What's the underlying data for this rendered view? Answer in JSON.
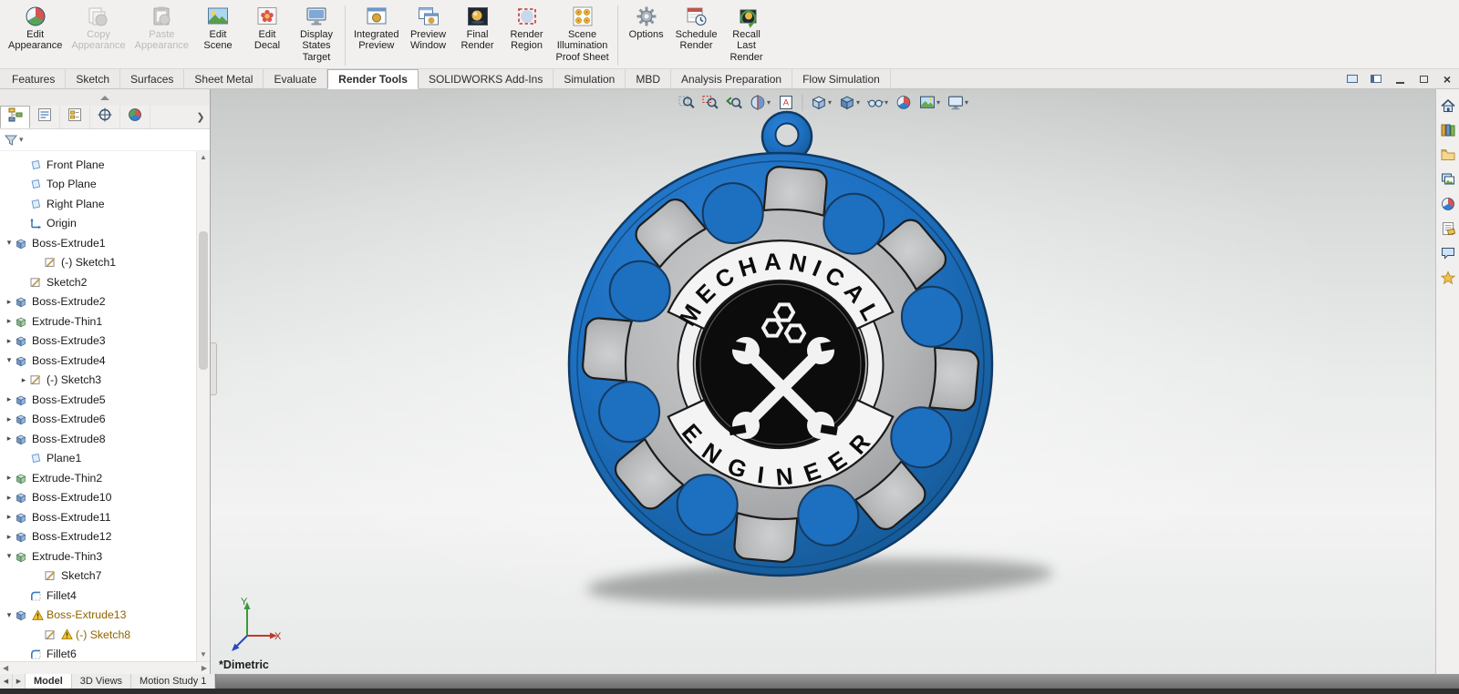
{
  "ribbon": {
    "buttons": [
      {
        "label": "Edit\nAppearance",
        "icon": "edit-appearance",
        "enabled": true
      },
      {
        "label": "Copy\nAppearance",
        "icon": "copy-appearance",
        "enabled": false
      },
      {
        "label": "Paste\nAppearance",
        "icon": "paste-appearance",
        "enabled": false
      },
      {
        "label": "Edit\nScene",
        "icon": "edit-scene",
        "enabled": true
      },
      {
        "label": "Edit\nDecal",
        "icon": "edit-decal",
        "enabled": true
      },
      {
        "label": "Display\nStates\nTarget",
        "icon": "display-states-target",
        "enabled": true
      },
      {
        "label": "Integrated\nPreview",
        "icon": "integrated-preview",
        "enabled": true,
        "group_start": true
      },
      {
        "label": "Preview\nWindow",
        "icon": "preview-window",
        "enabled": true
      },
      {
        "label": "Final\nRender",
        "icon": "final-render",
        "enabled": true
      },
      {
        "label": "Render\nRegion",
        "icon": "render-region",
        "enabled": true
      },
      {
        "label": "Scene\nIllumination\nProof Sheet",
        "icon": "scene-illumination-proof-sheet",
        "enabled": true
      },
      {
        "label": "Options",
        "icon": "options",
        "enabled": true,
        "group_start": true
      },
      {
        "label": "Schedule\nRender",
        "icon": "schedule-render",
        "enabled": true
      },
      {
        "label": "Recall\nLast\nRender",
        "icon": "recall-last-render",
        "enabled": true
      }
    ]
  },
  "command_tabs": {
    "items": [
      "Features",
      "Sketch",
      "Surfaces",
      "Sheet Metal",
      "Evaluate",
      "Render Tools",
      "SOLIDWORKS Add-Ins",
      "Simulation",
      "MBD",
      "Analysis Preparation",
      "Flow Simulation"
    ],
    "active": "Render Tools"
  },
  "manager_panel": {
    "tabs": [
      {
        "name": "featuremanager-design-tree"
      },
      {
        "name": "propertymanager"
      },
      {
        "name": "configurationmanager"
      },
      {
        "name": "dimxpertmanager"
      },
      {
        "name": "displaymanager"
      }
    ],
    "active_index": 0,
    "tree": {
      "items": [
        {
          "label": "Front Plane",
          "depth": 1,
          "icon": "plane"
        },
        {
          "label": "Top Plane",
          "depth": 1,
          "icon": "plane"
        },
        {
          "label": "Right Plane",
          "depth": 1,
          "icon": "plane"
        },
        {
          "label": "Origin",
          "depth": 1,
          "icon": "origin"
        },
        {
          "label": "Boss-Extrude1",
          "depth": 0,
          "expander": "expanded",
          "icon": "boss"
        },
        {
          "label": "(-) Sketch1",
          "depth": 2,
          "icon": "sketch"
        },
        {
          "label": "Sketch2",
          "depth": 1,
          "icon": "sketch"
        },
        {
          "label": "Boss-Extrude2",
          "depth": 0,
          "expander": "collapsed",
          "icon": "boss"
        },
        {
          "label": "Extrude-Thin1",
          "depth": 0,
          "expander": "collapsed",
          "icon": "thin"
        },
        {
          "label": "Boss-Extrude3",
          "depth": 0,
          "expander": "collapsed",
          "icon": "boss"
        },
        {
          "label": "Boss-Extrude4",
          "depth": 0,
          "expander": "expanded",
          "icon": "boss"
        },
        {
          "label": "(-) Sketch3",
          "depth": 1,
          "expander": "collapsed",
          "icon": "sketch"
        },
        {
          "label": "Boss-Extrude5",
          "depth": 0,
          "expander": "collapsed",
          "icon": "boss"
        },
        {
          "label": "Boss-Extrude6",
          "depth": 0,
          "expander": "collapsed",
          "icon": "boss"
        },
        {
          "label": "Boss-Extrude8",
          "depth": 0,
          "expander": "collapsed",
          "icon": "boss"
        },
        {
          "label": "Plane1",
          "depth": 1,
          "icon": "plane"
        },
        {
          "label": "Extrude-Thin2",
          "depth": 0,
          "expander": "collapsed",
          "icon": "thin"
        },
        {
          "label": "Boss-Extrude10",
          "depth": 0,
          "expander": "collapsed",
          "icon": "boss"
        },
        {
          "label": "Boss-Extrude11",
          "depth": 0,
          "expander": "collapsed",
          "icon": "boss"
        },
        {
          "label": "Boss-Extrude12",
          "depth": 0,
          "expander": "collapsed",
          "icon": "boss"
        },
        {
          "label": "Extrude-Thin3",
          "depth": 0,
          "expander": "expanded",
          "icon": "thin"
        },
        {
          "label": "Sketch7",
          "depth": 2,
          "icon": "sketch"
        },
        {
          "label": "Fillet4",
          "depth": 1,
          "icon": "fillet"
        },
        {
          "label": "Boss-Extrude13",
          "depth": 0,
          "expander": "expanded",
          "icon": "boss",
          "warning": true
        },
        {
          "label": "(-) Sketch8",
          "depth": 2,
          "icon": "sketch",
          "warning": true
        },
        {
          "label": "Fillet6",
          "depth": 1,
          "icon": "fillet"
        }
      ]
    }
  },
  "viewport": {
    "view_label": "*Dimetric",
    "triad": {
      "x_label": "X",
      "y_label": "Y"
    },
    "toolbar": [
      {
        "name": "zoom-to-fit"
      },
      {
        "name": "zoom-to-area"
      },
      {
        "name": "previous-view"
      },
      {
        "name": "section-view",
        "caret": true
      },
      {
        "name": "dynamic-annotation-views"
      },
      {
        "separator": true
      },
      {
        "name": "view-orientation",
        "caret": true
      },
      {
        "name": "display-style",
        "caret": true
      },
      {
        "name": "hide-show-items",
        "caret": true
      },
      {
        "name": "edit-appearance"
      },
      {
        "name": "apply-scene",
        "caret": true
      },
      {
        "name": "view-settings",
        "caret": true
      }
    ],
    "medallion": {
      "top_text": "MECHANICAL",
      "bottom_text": "ENGINEER",
      "colors": {
        "disc": "#1d6fbf",
        "gear": "#b4b6b8",
        "center": "#0c0c0c",
        "banner": "#f4f4f4"
      }
    }
  },
  "task_pane": {
    "items": [
      {
        "name": "solidworks-resources-home"
      },
      {
        "name": "design-library"
      },
      {
        "name": "file-explorer"
      },
      {
        "name": "view-palette"
      },
      {
        "name": "appearances-scenes-decals"
      },
      {
        "name": "custom-properties"
      },
      {
        "name": "solidworks-forum"
      },
      {
        "name": "favorites"
      }
    ]
  },
  "bottom_tabs": {
    "items": [
      "Model",
      "3D Views",
      "Motion Study 1"
    ],
    "active": "Model"
  }
}
